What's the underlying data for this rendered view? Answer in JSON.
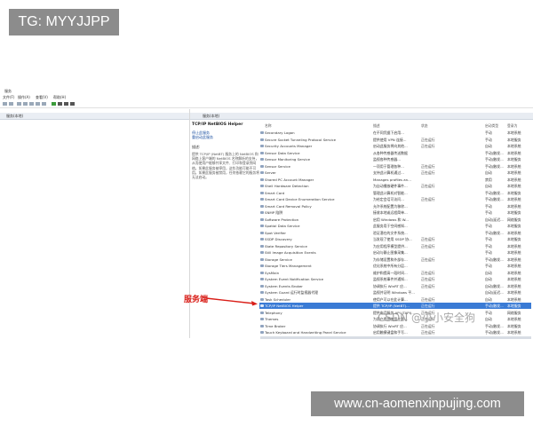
{
  "overlay": {
    "tag": "TG: MYYJJPP",
    "url": "www.cn-aomenxinpujing.com"
  },
  "window": {
    "title": "服务",
    "menu": [
      "文件(F)",
      "操作(A)",
      "查看(V)",
      "帮助(H)"
    ],
    "left_header": "服务(本地)",
    "right_header": "服务(本地)"
  },
  "selected_service": {
    "name": "TCP/IP NetBIOS Helper",
    "links": [
      "停止此服务",
      "重启动此服务"
    ],
    "desc_label": "描述:",
    "description": "提供 TCP/IP (NetBT) 服务上的 NetBIOS 和网络上客户端的 NetBIOS 名称解析的支持，从而使用户能够共享文件、打印和登录到网络。如果此服务被停用，这些功能可能不可用。如果此服务被禁用，任何依赖它的服务将无法启动。"
  },
  "columns": [
    "名称",
    "描述",
    "状态",
    "启动类型",
    "登录为"
  ],
  "services": [
    {
      "name": "Secondary Logon",
      "desc": "在不同凭据下启用...",
      "status": "",
      "start": "手动",
      "logon": "本地系统"
    },
    {
      "name": "Secure Socket Tunneling Protocol Service",
      "desc": "提供使用 VPN 连接...",
      "status": "正在运行",
      "start": "手动",
      "logon": "本地服务"
    },
    {
      "name": "Security Accounts Manager",
      "desc": "启动此服务将向其他...",
      "status": "正在运行",
      "start": "自动",
      "logon": "本地系统"
    },
    {
      "name": "Sensor Data Service",
      "desc": "从各种传感器传送数据",
      "status": "",
      "start": "手动(触发...",
      "logon": "本地系统"
    },
    {
      "name": "Sensor Monitoring Service",
      "desc": "监视各种传感器...",
      "status": "",
      "start": "手动(触发...",
      "logon": "本地服务"
    },
    {
      "name": "Sensor Service",
      "desc": "一项用于管理各种...",
      "status": "正在运行",
      "start": "手动(触发...",
      "logon": "本地系统"
    },
    {
      "name": "Server",
      "desc": "支持此计算机通过...",
      "status": "正在运行",
      "start": "自动",
      "logon": "本地系统"
    },
    {
      "name": "Shared PC Account Manager",
      "desc": "Manages profiles an...",
      "status": "",
      "start": "禁用",
      "logon": "本地系统"
    },
    {
      "name": "Shell Hardware Detection",
      "desc": "为自动播放硬件事件...",
      "status": "正在运行",
      "start": "自动",
      "logon": "本地系统"
    },
    {
      "name": "Smart Card",
      "desc": "管理此计算机对智能...",
      "status": "",
      "start": "手动(触发...",
      "logon": "本地服务"
    },
    {
      "name": "Smart Card Device Enumeration Service",
      "desc": "为给定会话可访问...",
      "status": "正在运行",
      "start": "手动(触发...",
      "logon": "本地系统"
    },
    {
      "name": "Smart Card Removal Policy",
      "desc": "允许系统配置为移除...",
      "status": "",
      "start": "手动",
      "logon": "本地系统"
    },
    {
      "name": "SNMP 陷阱",
      "desc": "接收本地或远程简单...",
      "status": "",
      "start": "手动",
      "logon": "本地服务"
    },
    {
      "name": "Software Protection",
      "desc": "启用 Windows 和 W...",
      "status": "",
      "start": "自动(延迟...",
      "logon": "网络服务"
    },
    {
      "name": "Spatial Data Service",
      "desc": "此服务用于空间感知...",
      "status": "",
      "start": "手动",
      "logon": "本地服务"
    },
    {
      "name": "Spot Verifier",
      "desc": "验证潜在的文件系统...",
      "status": "",
      "start": "手动(触发...",
      "logon": "本地系统"
    },
    {
      "name": "SSDP Discovery",
      "desc": "当发现了使用 SSDP 协...",
      "status": "正在运行",
      "start": "手动",
      "logon": "本地服务"
    },
    {
      "name": "State Repository Service",
      "desc": "为应用程序模型提供...",
      "status": "正在运行",
      "start": "手动",
      "logon": "本地系统"
    },
    {
      "name": "Still Image Acquisition Events",
      "desc": "启动与静止图像采集...",
      "status": "",
      "start": "手动",
      "logon": "本地系统"
    },
    {
      "name": "Storage Service",
      "desc": "为存储设置和外部存...",
      "status": "正在运行",
      "start": "手动(触发...",
      "logon": "本地系统"
    },
    {
      "name": "Storage Tiers Management",
      "desc": "优化系统中所有分层...",
      "status": "",
      "start": "手动",
      "logon": "本地系统"
    },
    {
      "name": "SysMain",
      "desc": "维护和提高一段时间...",
      "status": "正在运行",
      "start": "自动",
      "logon": "本地系统"
    },
    {
      "name": "System Event Notification Service",
      "desc": "监视系统事件并通知...",
      "status": "正在运行",
      "start": "自动",
      "logon": "本地系统"
    },
    {
      "name": "System Events Broker",
      "desc": "协调执行 WinRT 应...",
      "status": "正在运行",
      "start": "自动(触发...",
      "logon": "本地系统"
    },
    {
      "name": "System Guard 运行时监视器代理",
      "desc": "监视并证明 Windows 平...",
      "status": "",
      "start": "自动(延迟...",
      "logon": "本地系统"
    },
    {
      "name": "Task Scheduler",
      "desc": "使用户可以在此计算...",
      "status": "正在运行",
      "start": "自动",
      "logon": "本地系统"
    },
    {
      "name": "TCP/IP NetBIOS Helper",
      "desc": "提供 TCP/IP (NetBT)...",
      "status": "正在运行",
      "start": "手动(触发...",
      "logon": "本地服务"
    },
    {
      "name": "Telephony",
      "desc": "提供电话服务 API (TAPI)...",
      "status": "正在运行",
      "start": "手动",
      "logon": "网络服务"
    },
    {
      "name": "Themes",
      "desc": "为用户提供使用主题...",
      "status": "正在运行",
      "start": "自动",
      "logon": "本地系统"
    },
    {
      "name": "Time Broker",
      "desc": "协调执行 WinRT 应...",
      "status": "正在运行",
      "start": "手动(触发...",
      "logon": "本地服务"
    },
    {
      "name": "Touch Keyboard and Handwriting Panel Service",
      "desc": "启用触摸键盘和手写...",
      "status": "正在运行",
      "start": "手动(触发...",
      "logon": "本地系统"
    }
  ],
  "selected_index": 26,
  "annotation": {
    "label": "服务端",
    "color": "#d91e18"
  },
  "watermark": "CSDN @小小安全狗"
}
